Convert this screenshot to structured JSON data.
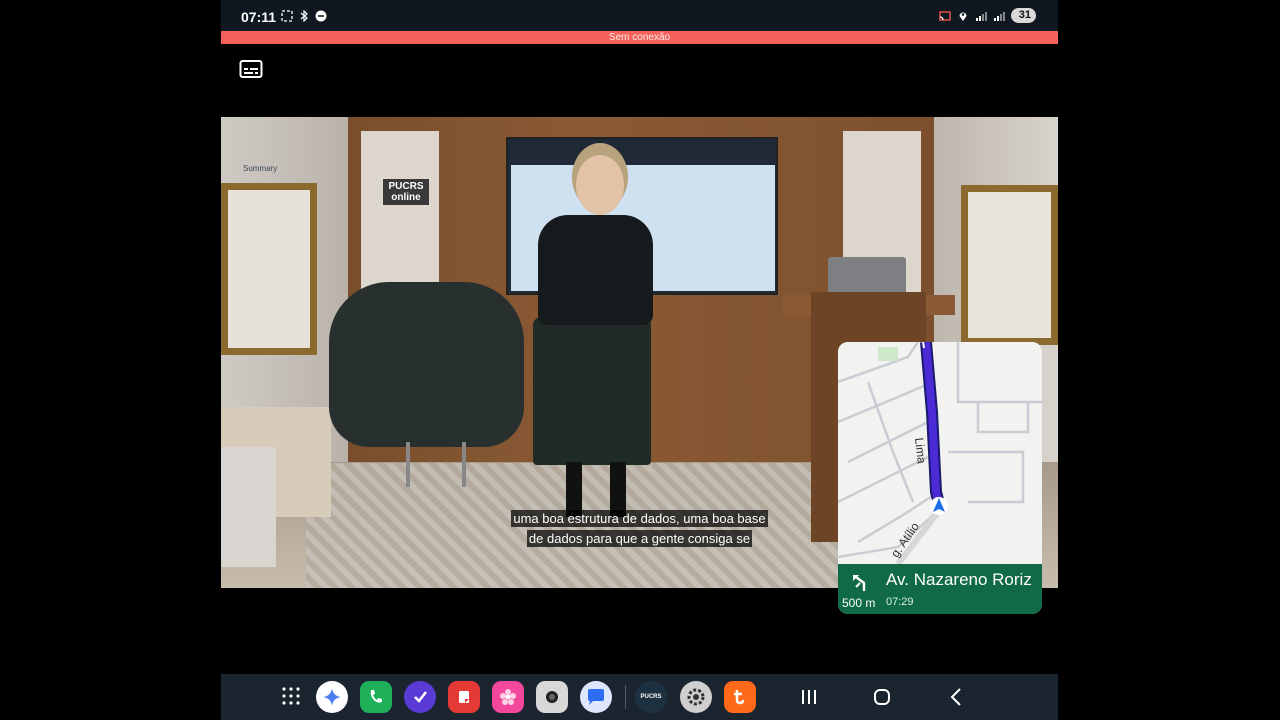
{
  "status_bar": {
    "time": "07:11",
    "battery": "31",
    "left_icons": [
      "screenshot-icon",
      "bluetooth-icon",
      "notification-icon"
    ],
    "right_icons": [
      "cast-icon",
      "location-icon",
      "signal-icon",
      "signal-icon-2"
    ]
  },
  "offline_banner": "Sem conexão",
  "video": {
    "logo": "PUCRS online",
    "screen_title": "Summary",
    "subtitle_line1": "uma boa estrutura de dados, uma boa base",
    "subtitle_line2": "de dados para que a gente consiga se"
  },
  "navigation": {
    "street": "Av. Nazareno Roriz",
    "distance": "500 m",
    "eta": "07:29",
    "map_label_1": "Lima",
    "map_label_2": "g. Atílio",
    "route_color": "#4b2bd6",
    "banner_color": "#0f6a45"
  },
  "taskbar": {
    "apps": [
      {
        "name": "gemini",
        "color": "#ffffff"
      },
      {
        "name": "phone",
        "color": "#1fb15a"
      },
      {
        "name": "tasks",
        "color": "#5b3bd6"
      },
      {
        "name": "notes",
        "color": "#e53935"
      },
      {
        "name": "photos",
        "color": "#f2479b"
      },
      {
        "name": "camera",
        "color": "#d8d8d8"
      },
      {
        "name": "messages",
        "color": "#dfe7ff"
      },
      {
        "name": "pucrs",
        "color": "#1e3140"
      },
      {
        "name": "settings",
        "color": "#cfcfcf"
      },
      {
        "name": "tuya",
        "color": "#ff6a1a"
      }
    ],
    "pucrs_label": "PUCRS"
  }
}
